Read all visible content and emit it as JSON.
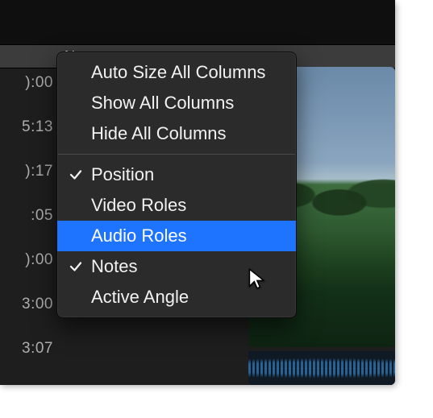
{
  "header": {
    "partial_label": "N"
  },
  "timecodes": [
    "):00",
    "5:13",
    "):17",
    ":05",
    "):00",
    "3:00",
    "3:07"
  ],
  "menu": {
    "actions": [
      {
        "label": "Auto Size All Columns"
      },
      {
        "label": "Show All Columns"
      },
      {
        "label": "Hide All Columns"
      }
    ],
    "columns": [
      {
        "label": "Position",
        "checked": true,
        "highlighted": false
      },
      {
        "label": "Video Roles",
        "checked": false,
        "highlighted": false
      },
      {
        "label": "Audio Roles",
        "checked": false,
        "highlighted": true
      },
      {
        "label": "Notes",
        "checked": true,
        "highlighted": false
      },
      {
        "label": "Active Angle",
        "checked": false,
        "highlighted": false
      }
    ]
  }
}
